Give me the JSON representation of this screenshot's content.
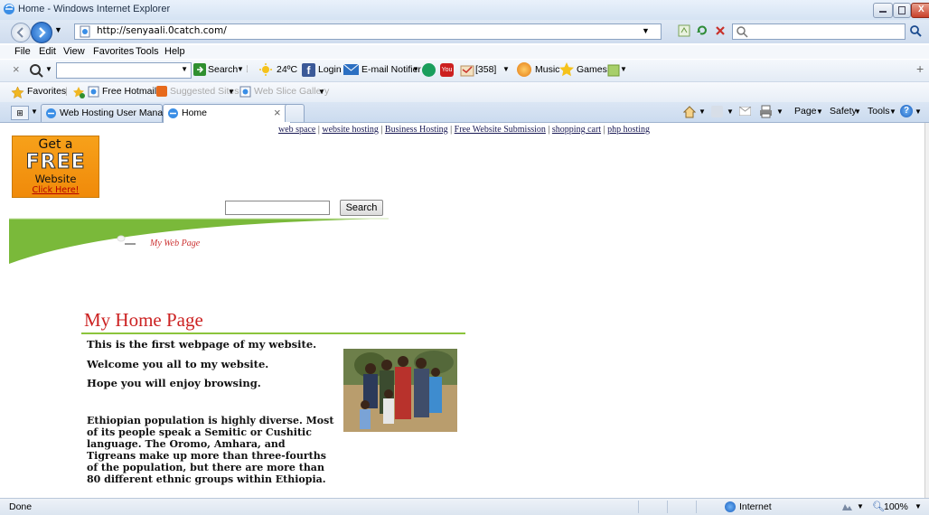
{
  "window": {
    "title": "Home - Windows Internet Explorer"
  },
  "address_bar": {
    "url": "http://senyaali.0catch.com/"
  },
  "menu": [
    "File",
    "Edit",
    "View",
    "Favorites",
    "Tools",
    "Help"
  ],
  "toolbar": {
    "search_label": "Search",
    "weather": "24ºC",
    "login": "Login",
    "email_notifier": "E-mail Notifier",
    "count": "[358]",
    "music": "Music",
    "games": "Games"
  },
  "favorites_bar": {
    "favorites": "Favorites",
    "free_hotmail": "Free Hotmail",
    "suggested_sites": "Suggested Sites",
    "web_slice_gallery": "Web Slice Gallery"
  },
  "tabs": [
    {
      "label": "Web Hosting User Manage..."
    },
    {
      "label": "Home"
    }
  ],
  "command_bar": {
    "page": "Page",
    "safety": "Safety",
    "tools": "Tools"
  },
  "page": {
    "top_links": [
      "web space",
      "website hosting",
      "Business Hosting",
      "Free Website Submission",
      "shopping cart",
      "php hosting"
    ],
    "banner": {
      "line1": "Get a",
      "line2": "FREE",
      "line3": "Website",
      "line4": "Click Here!"
    },
    "search_button": "Search",
    "site_tagline": "My Web Page",
    "heading": "My Home Page",
    "para1": "This  is the first webpage of my website.",
    "para2": "Welcome you all to  my website.",
    "para3": "Hope you will enjoy browsing.",
    "para4": "Ethiopian population is highly diverse. Most of its people speak a Semitic or Cushitic language. The Oromo, Amhara, and Tigreans make up more than three-fourths of the population, but there are more than 80 different ethnic groups within Ethiopia."
  },
  "status_bar": {
    "status": "Done",
    "zone": "Internet",
    "zoom": "100%"
  }
}
